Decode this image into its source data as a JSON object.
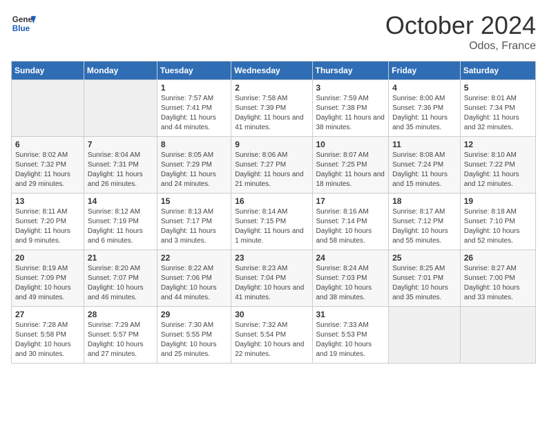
{
  "header": {
    "logo_line1": "General",
    "logo_line2": "Blue",
    "month_title": "October 2024",
    "location": "Odos, France"
  },
  "columns": [
    "Sunday",
    "Monday",
    "Tuesday",
    "Wednesday",
    "Thursday",
    "Friday",
    "Saturday"
  ],
  "weeks": [
    [
      {
        "day": "",
        "sunrise": "",
        "sunset": "",
        "daylight": ""
      },
      {
        "day": "",
        "sunrise": "",
        "sunset": "",
        "daylight": ""
      },
      {
        "day": "1",
        "sunrise": "Sunrise: 7:57 AM",
        "sunset": "Sunset: 7:41 PM",
        "daylight": "Daylight: 11 hours and 44 minutes."
      },
      {
        "day": "2",
        "sunrise": "Sunrise: 7:58 AM",
        "sunset": "Sunset: 7:39 PM",
        "daylight": "Daylight: 11 hours and 41 minutes."
      },
      {
        "day": "3",
        "sunrise": "Sunrise: 7:59 AM",
        "sunset": "Sunset: 7:38 PM",
        "daylight": "Daylight: 11 hours and 38 minutes."
      },
      {
        "day": "4",
        "sunrise": "Sunrise: 8:00 AM",
        "sunset": "Sunset: 7:36 PM",
        "daylight": "Daylight: 11 hours and 35 minutes."
      },
      {
        "day": "5",
        "sunrise": "Sunrise: 8:01 AM",
        "sunset": "Sunset: 7:34 PM",
        "daylight": "Daylight: 11 hours and 32 minutes."
      }
    ],
    [
      {
        "day": "6",
        "sunrise": "Sunrise: 8:02 AM",
        "sunset": "Sunset: 7:32 PM",
        "daylight": "Daylight: 11 hours and 29 minutes."
      },
      {
        "day": "7",
        "sunrise": "Sunrise: 8:04 AM",
        "sunset": "Sunset: 7:31 PM",
        "daylight": "Daylight: 11 hours and 26 minutes."
      },
      {
        "day": "8",
        "sunrise": "Sunrise: 8:05 AM",
        "sunset": "Sunset: 7:29 PM",
        "daylight": "Daylight: 11 hours and 24 minutes."
      },
      {
        "day": "9",
        "sunrise": "Sunrise: 8:06 AM",
        "sunset": "Sunset: 7:27 PM",
        "daylight": "Daylight: 11 hours and 21 minutes."
      },
      {
        "day": "10",
        "sunrise": "Sunrise: 8:07 AM",
        "sunset": "Sunset: 7:25 PM",
        "daylight": "Daylight: 11 hours and 18 minutes."
      },
      {
        "day": "11",
        "sunrise": "Sunrise: 8:08 AM",
        "sunset": "Sunset: 7:24 PM",
        "daylight": "Daylight: 11 hours and 15 minutes."
      },
      {
        "day": "12",
        "sunrise": "Sunrise: 8:10 AM",
        "sunset": "Sunset: 7:22 PM",
        "daylight": "Daylight: 11 hours and 12 minutes."
      }
    ],
    [
      {
        "day": "13",
        "sunrise": "Sunrise: 8:11 AM",
        "sunset": "Sunset: 7:20 PM",
        "daylight": "Daylight: 11 hours and 9 minutes."
      },
      {
        "day": "14",
        "sunrise": "Sunrise: 8:12 AM",
        "sunset": "Sunset: 7:19 PM",
        "daylight": "Daylight: 11 hours and 6 minutes."
      },
      {
        "day": "15",
        "sunrise": "Sunrise: 8:13 AM",
        "sunset": "Sunset: 7:17 PM",
        "daylight": "Daylight: 11 hours and 3 minutes."
      },
      {
        "day": "16",
        "sunrise": "Sunrise: 8:14 AM",
        "sunset": "Sunset: 7:15 PM",
        "daylight": "Daylight: 11 hours and 1 minute."
      },
      {
        "day": "17",
        "sunrise": "Sunrise: 8:16 AM",
        "sunset": "Sunset: 7:14 PM",
        "daylight": "Daylight: 10 hours and 58 minutes."
      },
      {
        "day": "18",
        "sunrise": "Sunrise: 8:17 AM",
        "sunset": "Sunset: 7:12 PM",
        "daylight": "Daylight: 10 hours and 55 minutes."
      },
      {
        "day": "19",
        "sunrise": "Sunrise: 8:18 AM",
        "sunset": "Sunset: 7:10 PM",
        "daylight": "Daylight: 10 hours and 52 minutes."
      }
    ],
    [
      {
        "day": "20",
        "sunrise": "Sunrise: 8:19 AM",
        "sunset": "Sunset: 7:09 PM",
        "daylight": "Daylight: 10 hours and 49 minutes."
      },
      {
        "day": "21",
        "sunrise": "Sunrise: 8:20 AM",
        "sunset": "Sunset: 7:07 PM",
        "daylight": "Daylight: 10 hours and 46 minutes."
      },
      {
        "day": "22",
        "sunrise": "Sunrise: 8:22 AM",
        "sunset": "Sunset: 7:06 PM",
        "daylight": "Daylight: 10 hours and 44 minutes."
      },
      {
        "day": "23",
        "sunrise": "Sunrise: 8:23 AM",
        "sunset": "Sunset: 7:04 PM",
        "daylight": "Daylight: 10 hours and 41 minutes."
      },
      {
        "day": "24",
        "sunrise": "Sunrise: 8:24 AM",
        "sunset": "Sunset: 7:03 PM",
        "daylight": "Daylight: 10 hours and 38 minutes."
      },
      {
        "day": "25",
        "sunrise": "Sunrise: 8:25 AM",
        "sunset": "Sunset: 7:01 PM",
        "daylight": "Daylight: 10 hours and 35 minutes."
      },
      {
        "day": "26",
        "sunrise": "Sunrise: 8:27 AM",
        "sunset": "Sunset: 7:00 PM",
        "daylight": "Daylight: 10 hours and 33 minutes."
      }
    ],
    [
      {
        "day": "27",
        "sunrise": "Sunrise: 7:28 AM",
        "sunset": "Sunset: 5:58 PM",
        "daylight": "Daylight: 10 hours and 30 minutes."
      },
      {
        "day": "28",
        "sunrise": "Sunrise: 7:29 AM",
        "sunset": "Sunset: 5:57 PM",
        "daylight": "Daylight: 10 hours and 27 minutes."
      },
      {
        "day": "29",
        "sunrise": "Sunrise: 7:30 AM",
        "sunset": "Sunset: 5:55 PM",
        "daylight": "Daylight: 10 hours and 25 minutes."
      },
      {
        "day": "30",
        "sunrise": "Sunrise: 7:32 AM",
        "sunset": "Sunset: 5:54 PM",
        "daylight": "Daylight: 10 hours and 22 minutes."
      },
      {
        "day": "31",
        "sunrise": "Sunrise: 7:33 AM",
        "sunset": "Sunset: 5:53 PM",
        "daylight": "Daylight: 10 hours and 19 minutes."
      },
      {
        "day": "",
        "sunrise": "",
        "sunset": "",
        "daylight": ""
      },
      {
        "day": "",
        "sunrise": "",
        "sunset": "",
        "daylight": ""
      }
    ]
  ]
}
